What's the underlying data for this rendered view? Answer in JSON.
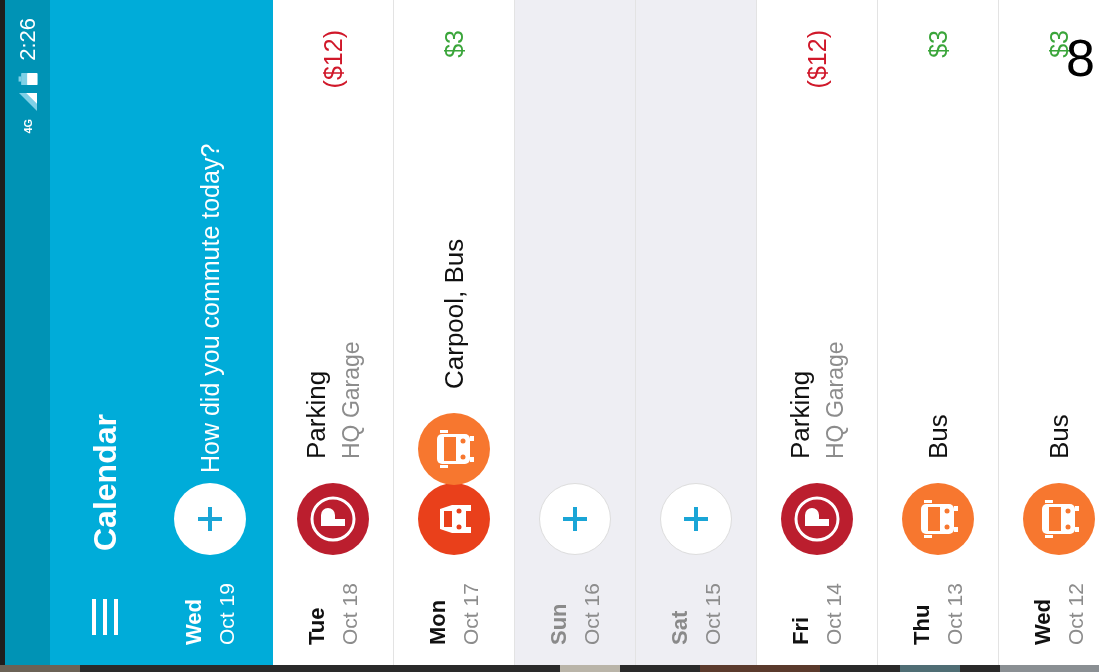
{
  "status_bar": {
    "network": "4G",
    "time": "2:26"
  },
  "app_bar": {
    "title": "Calendar",
    "today": {
      "weekday": "Wed",
      "date": "Oct 19",
      "prompt": "How did you commute today?"
    }
  },
  "days": [
    {
      "weekday": "Tue",
      "date": "Oct 18",
      "weekend": false,
      "entries": [
        {
          "kind": "parking"
        }
      ],
      "title": "Parking",
      "subtitle": "HQ Garage",
      "amount": {
        "text": "($12)",
        "color": "#d0182a"
      }
    },
    {
      "weekday": "Mon",
      "date": "Oct 17",
      "weekend": false,
      "entries": [
        {
          "kind": "car"
        },
        {
          "kind": "bus"
        }
      ],
      "title": "Carpool, Bus",
      "amount": {
        "text": "$3",
        "color": "#3aa53a"
      }
    },
    {
      "weekday": "Sun",
      "date": "Oct 16",
      "weekend": true
    },
    {
      "weekday": "Sat",
      "date": "Oct 15",
      "weekend": true
    },
    {
      "weekday": "Fri",
      "date": "Oct 14",
      "weekend": false,
      "entries": [
        {
          "kind": "parking"
        }
      ],
      "title": "Parking",
      "subtitle": "HQ Garage",
      "amount": {
        "text": "($12)",
        "color": "#d0182a"
      }
    },
    {
      "weekday": "Thu",
      "date": "Oct 13",
      "weekend": false,
      "entries": [
        {
          "kind": "bus"
        }
      ],
      "title": "Bus",
      "amount": {
        "text": "$3",
        "color": "#3aa53a"
      }
    },
    {
      "weekday": "Wed",
      "date": "Oct 12",
      "weekend": false,
      "entries": [
        {
          "kind": "bus"
        }
      ],
      "title": "Bus",
      "amount": {
        "text": "$3",
        "color": "#3aa53a"
      }
    }
  ],
  "overlay_text": "8"
}
